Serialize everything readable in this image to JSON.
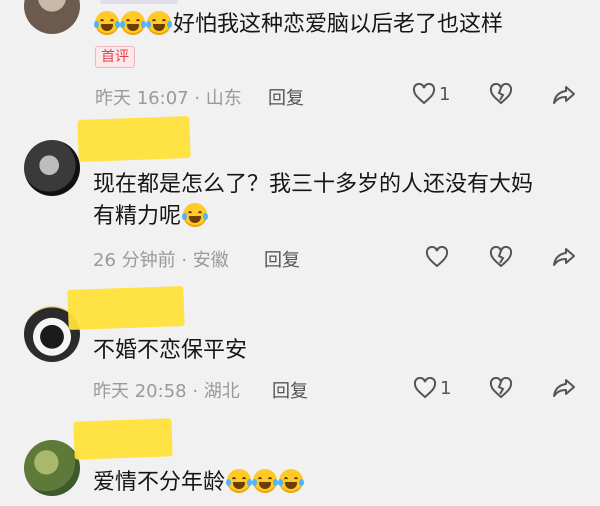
{
  "comments": [
    {
      "text": "好怕我这种恋爱脑以后老了也这样",
      "badge": "首评",
      "time_location": "昨天 16:07 · 山东",
      "reply_label": "回复",
      "like_count": "1",
      "emoji_prefix_count": 3
    },
    {
      "text_line1": "现在都是怎么了？我三十多岁的人还没有大妈",
      "text_line2": "有精力呢",
      "time_location": "26 分钟前 · 安徽",
      "reply_label": "回复",
      "like_count": ""
    },
    {
      "text": "不婚不恋保平安",
      "time_location": "昨天 20:58 · 湖北",
      "reply_label": "回复",
      "like_count": "1"
    },
    {
      "text": "爱情不分年龄",
      "emoji_suffix_count": 3
    }
  ],
  "icons": {
    "like": "heart-outline-icon",
    "dislike": "broken-heart-icon",
    "share": "share-arrow-icon",
    "emoji": "laugh-cry-emoji-icon"
  },
  "colors": {
    "background": "#f1f1f1",
    "highlight": "#ffe03a",
    "badge_text": "#e0434c",
    "meta": "#9a9a9a"
  }
}
